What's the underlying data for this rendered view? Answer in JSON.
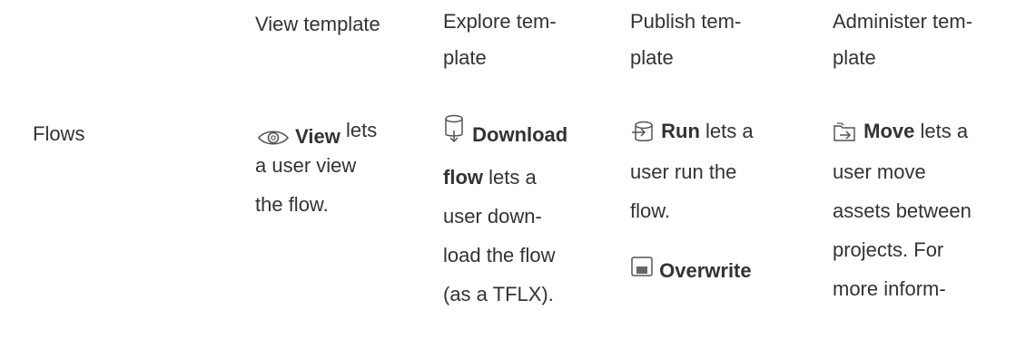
{
  "headers": [
    {
      "line1": "View template",
      "line2": ""
    },
    {
      "line1": "Explore tem-",
      "line2": "plate"
    },
    {
      "line1": "Publish tem-",
      "line2": "plate"
    },
    {
      "line1": "Administer tem-",
      "line2": "plate"
    }
  ],
  "row": {
    "label": "Flows",
    "view": {
      "icon": "eye-icon",
      "bold": "View",
      "lets": "lets",
      "lines": [
        "a user view",
        "the flow."
      ]
    },
    "explore": {
      "icon": "download-database-icon",
      "bold1": "Download",
      "bold2": "flow",
      "rest2": " lets a",
      "lines": [
        "user down-",
        "load the flow",
        "(as a TFLX)."
      ]
    },
    "publish": {
      "run_icon": "run-flow-icon",
      "run_bold": "Run",
      "run_rest": " lets a",
      "lines": [
        "user run the",
        "flow."
      ],
      "overwrite_icon": "save-icon",
      "overwrite_bold": "Overwrite"
    },
    "administer": {
      "icon": "move-icon",
      "bold": "Move",
      "rest": " lets a",
      "lines": [
        "user move",
        "assets between",
        "projects. For",
        "more inform-"
      ]
    }
  }
}
